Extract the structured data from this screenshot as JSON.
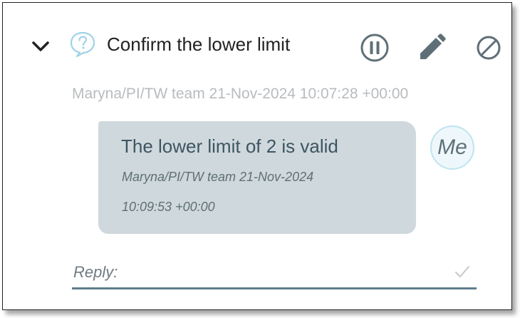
{
  "comment": {
    "title": "Confirm the lower limit",
    "meta": "Maryna/PI/TW team 21-Nov-2024 10:07:28 +00:00",
    "icons": [
      "chevron-down-icon",
      "question-bubble-icon",
      "pause-icon",
      "pencil-icon",
      "cancel-icon"
    ]
  },
  "reply_bubble": {
    "text": "The lower limit of 2 is valid",
    "meta_line1": "Maryna/PI/TW team 21-Nov-2024",
    "meta_line2": "10:09:53 +00:00",
    "avatar_label": "Me"
  },
  "reply_box": {
    "placeholder": "Reply:",
    "value": "",
    "submit_icon": "check-icon"
  },
  "colors": {
    "bubble_bg": "#cfd8dc",
    "text_dark": "#3d5563",
    "muted": "#b8bcbf",
    "icon": "#5f6f78",
    "accent_icon": "#9fd3e6"
  }
}
